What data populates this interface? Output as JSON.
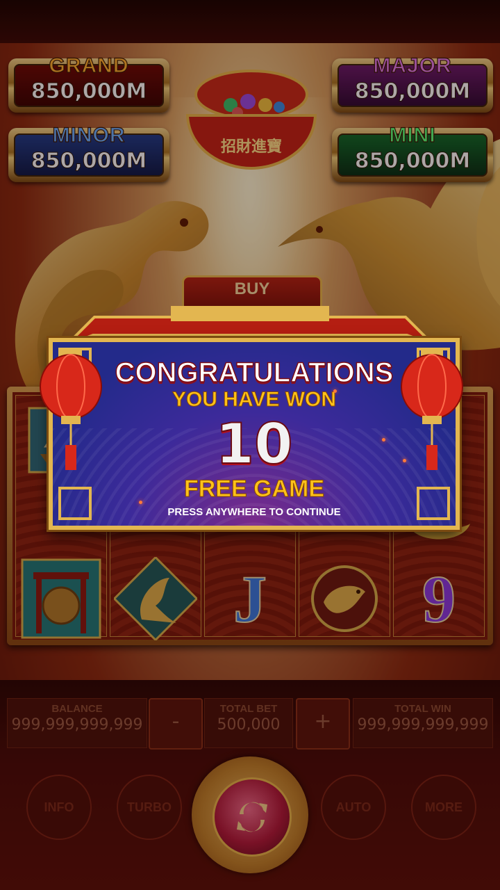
{
  "jackpots": {
    "grand": {
      "label": "GRAND",
      "value": "850,000M"
    },
    "major": {
      "label": "MAJOR",
      "value": "850,000M"
    },
    "minor": {
      "label": "MINOR",
      "value": "850,000M"
    },
    "mini": {
      "label": "MINI",
      "value": "850,000M"
    }
  },
  "bowl": {
    "characters": "招財進寶"
  },
  "buy_button": {
    "label": "BUY"
  },
  "popup": {
    "title": "CONGRATULATIONS",
    "subtitle": "YOU HAVE WON",
    "count": "10",
    "reward": "FREE GAME",
    "hint": "PRESS ANYWHERE TO CONTINUE"
  },
  "reels": {
    "visible_symbols": [
      {
        "reel": 1,
        "name": "ship-symbol"
      },
      {
        "reel": 1,
        "name": "gong-symbol"
      },
      {
        "reel": 2,
        "name": "phoenix-symbol"
      },
      {
        "reel": 3,
        "name": "letter-j-symbol",
        "text": "J"
      },
      {
        "reel": 4,
        "name": "koi-fish-symbol"
      },
      {
        "reel": 5,
        "name": "gold-ingot-symbol"
      },
      {
        "reel": 5,
        "name": "nine-symbol",
        "text": "9"
      }
    ]
  },
  "controls": {
    "balance": {
      "label": "BALANCE",
      "value": "999,999,999,999"
    },
    "total_bet": {
      "label": "TOTAL BET",
      "value": "500,000"
    },
    "total_win": {
      "label": "TOTAL WIN",
      "value": "999,999,999,999"
    },
    "minus_label": "-",
    "plus_label": "+",
    "info_label": "INFO",
    "turbo_label": "TURBO",
    "auto_label": "AUTO",
    "more_label": "MORE"
  },
  "colors": {
    "gold": "#e3b650",
    "popup_blue": "#232a8a",
    "grand": "#ffb030",
    "major": "#e07ae8",
    "minor": "#6ab0ff",
    "mini": "#5aff7a"
  }
}
